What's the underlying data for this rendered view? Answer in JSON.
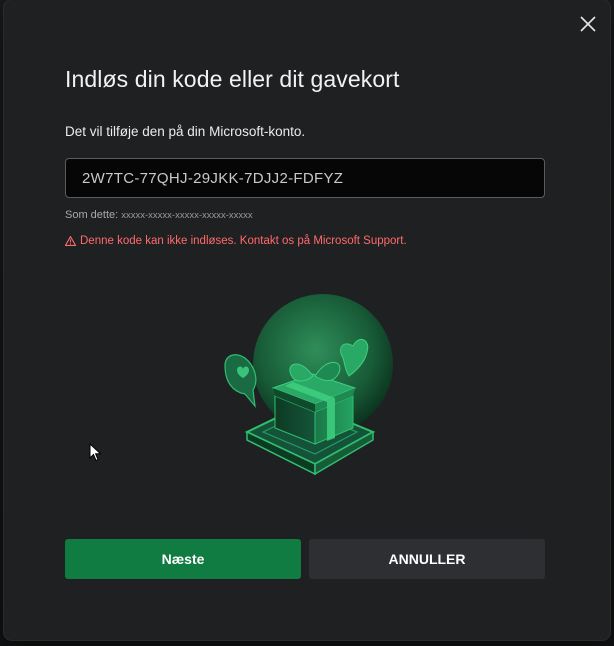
{
  "dialog": {
    "title": "Indløs din kode eller dit gavekort",
    "subtitle": "Det vil tilføje den på din Microsoft-konto.",
    "code_input": {
      "value": "2W7TC-77QHJ-29JKK-7DJJ2-FDFYZ",
      "placeholder": ""
    },
    "format_hint_label": "Som dette:",
    "format_hint_pattern": "xxxxx-xxxxx-xxxxx-xxxxx-xxxxx",
    "error_icon": "warning-icon",
    "error_text": "Denne kode kan ikke indløses. Kontakt os på Microsoft Support.",
    "next_button": "Næste",
    "cancel_button": "ANNULLER",
    "close_icon": "close-icon"
  },
  "colors": {
    "dialog_bg": "#1f2022",
    "accent_green": "#107c41",
    "error_red": "#ff6b6b",
    "cancel_bg": "#2e2f33"
  },
  "illustration": "gift-box-with-hearts"
}
